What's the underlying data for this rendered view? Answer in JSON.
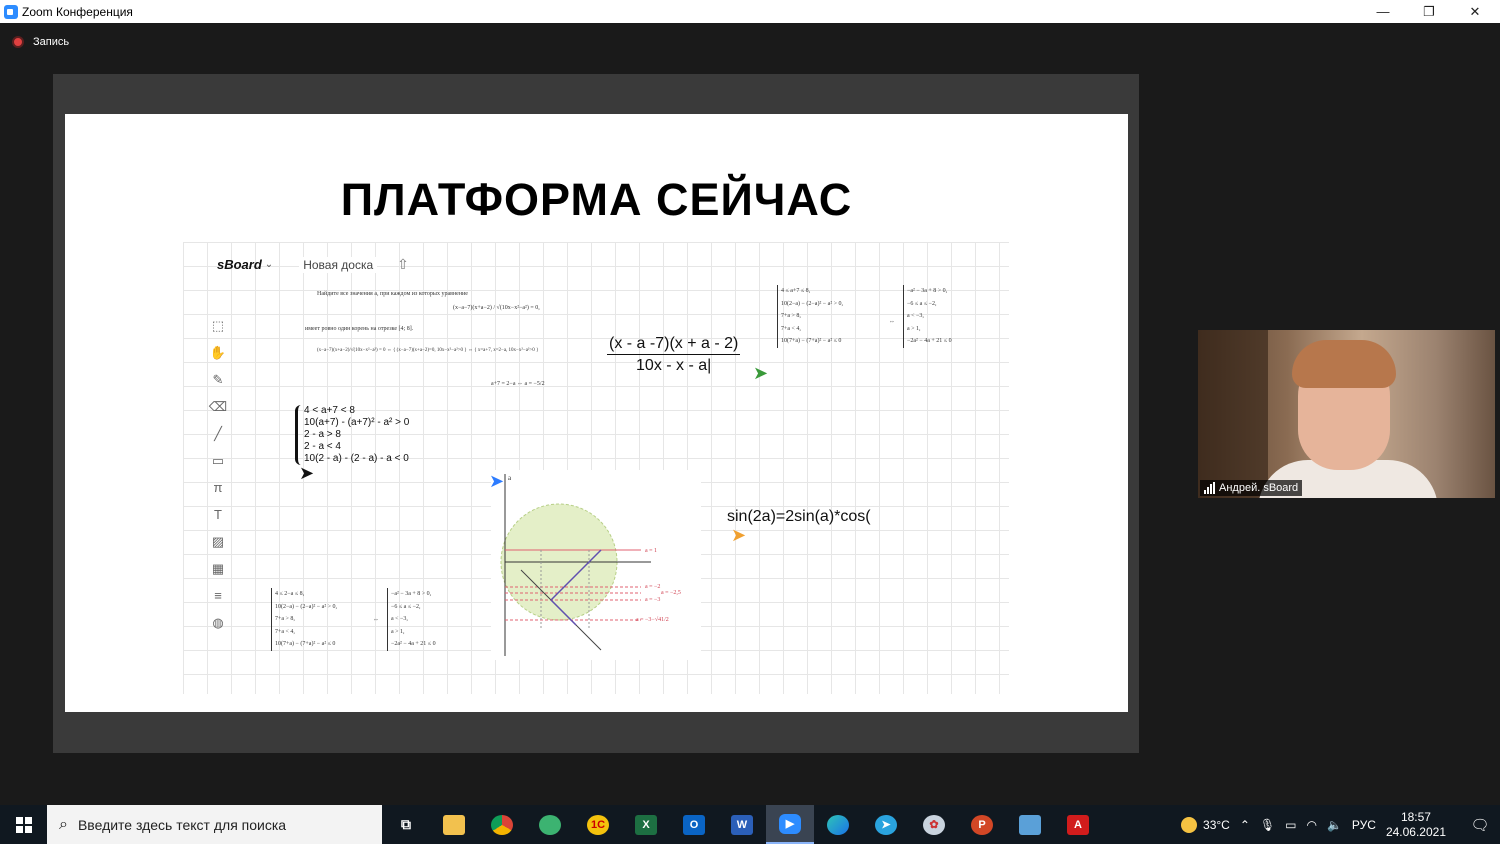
{
  "window": {
    "title": "Zoom Конференция",
    "min": "—",
    "max": "❐",
    "close": "✕"
  },
  "meeting": {
    "recording_label": "Запись"
  },
  "slide": {
    "title": "ПЛАТФОРМА СЕЙЧАС",
    "board": {
      "logo": "sBoard",
      "board_name": "Новая доска",
      "tools": [
        "select-icon",
        "hand-icon",
        "pencil-icon",
        "eraser-icon",
        "line-icon",
        "rectangle-icon",
        "pi-icon",
        "text-icon",
        "image-icon",
        "grid-icon",
        "lines-icon",
        "palette-icon"
      ],
      "problem_text": "Найдите все значения a, при каждом из которых уравнение",
      "problem_text2": "имеет ровно один корень на отрезке [4; 8].",
      "problem_eq": "(x−a−7)(x+a−2) / √(10x−x²−a²) = 0,",
      "problem_steps": [
        "(x−a−7)(x+a−2)/√(10x−x²−a²) = 0 ⇔ { (x−a−7)(x+a−2)=0, 10x−x²−a²>0 } ⇔ { x=a+7, x=2−a, 10x−x²−a²>0 }",
        "a+7 = 2−a ⇔ a = −5/2"
      ],
      "handwritten_system": [
        "4 < a+7 < 8",
        "10(a+7) - (a+7)² - a² > 0",
        "2 - a > 8",
        "2 - a < 4",
        "10(2 - a) - (2 - a) - a < 0"
      ],
      "fraction_numerator": "(x - a -7)(x + a - 2)",
      "fraction_denominator": "10x - x - a|",
      "typed_formula": "sin(2a)=2sin(a)*cos(",
      "top_right_system_left": [
        "4 ≤ a+7 ≤ 8,",
        "10(2−a) − (2−a)² − a² > 0,",
        "7+a > 8,",
        "7+a < 4,",
        "10(7+a) − (7+a)² − a² ≤ 0"
      ],
      "top_right_system_right": [
        "−a² − 3a + 8 > 0,",
        "−6 ≤ a ≤ −2,",
        "a < −3,",
        "a > 1,",
        "−2a² − 4a + 21 ≤ 0"
      ],
      "bottom_left_system_left": [
        "4 ≤ 2−a ≤ 8,",
        "10(2−a) − (2−a)² − a² > 0,",
        "7+a > 8,",
        "7+a < 4,",
        "10(7+a) − (7+a)² − a² ≤ 0"
      ],
      "bottom_left_system_right": [
        "−a² − 3a + 8 > 0,",
        "−6 ≤ a ≤ −2,",
        "a < −3,",
        "a > 1,",
        "−2a² − 4a + 21 ≤ 0"
      ],
      "graph_labels": [
        "a = 1",
        "a = −2",
        "a = −2,5",
        "a = −3",
        "a = −3−√41/2",
        "a"
      ]
    }
  },
  "participant": {
    "name": "Андрей. sBoard"
  },
  "taskbar": {
    "search_placeholder": "Введите здесь текст для поиска",
    "apps": [
      "task-view-icon",
      "file-explorer-icon",
      "chrome-icon",
      "maps-icon",
      "1c-icon",
      "excel-icon",
      "outlook-icon",
      "word-icon",
      "zoom-icon",
      "edge-icon",
      "telegram-icon",
      "paint-icon",
      "powerpoint-icon",
      "photos-icon",
      "acrobat-icon"
    ],
    "temperature": "33°C",
    "language": "РУС",
    "time": "18:57",
    "date": "24.06.2021"
  }
}
